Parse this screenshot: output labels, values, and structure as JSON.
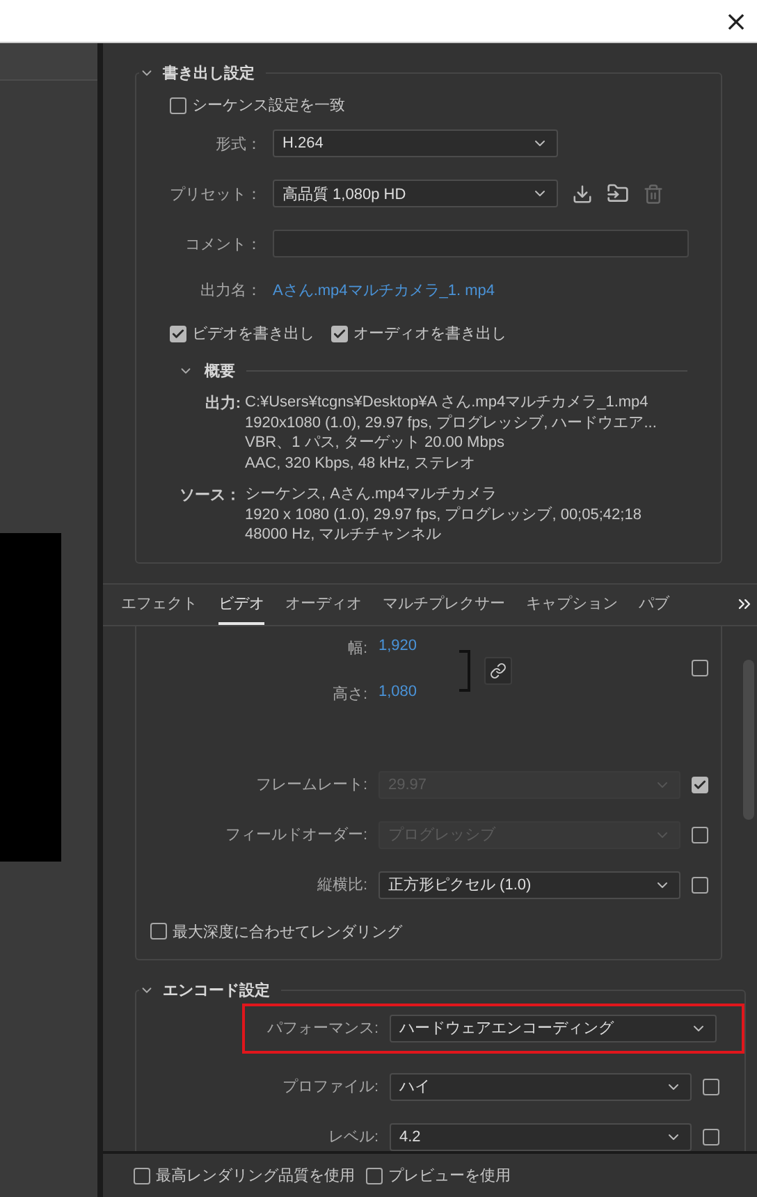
{
  "window": {
    "close": "×"
  },
  "export_settings": {
    "title": "書き出し設定",
    "match_sequence": {
      "label": "シーケンス設定を一致",
      "checked": false
    },
    "fields": [
      {
        "kind": "dropdown",
        "label": "形式：",
        "value": "H.264"
      },
      {
        "kind": "preset",
        "label": "プリセット：",
        "value": "高品質 1,080p HD"
      },
      {
        "kind": "input",
        "label": "コメント："
      },
      {
        "kind": "link",
        "label": "出力名：",
        "value": "Aさん.mp4マルチカメラ_1. mp4"
      }
    ],
    "export_options": [
      {
        "label": "ビデオを書き出し",
        "checked": true
      },
      {
        "label": "オーディオを書き出し",
        "checked": true
      }
    ],
    "summary": {
      "title": "概要",
      "groups": [
        {
          "label": "出力:",
          "lines": [
            "C:¥Users¥tcgns¥Desktop¥A さん.mp4マルチカメラ_1.mp4",
            "1920x1080 (1.0), 29.97 fps, プログレッシブ, ハードウエア...",
            "VBR、1 パス, ターゲット 20.00 Mbps",
            "AAC, 320 Kbps, 48 kHz, ステレオ"
          ]
        },
        {
          "label": "ソース：",
          "lines": [
            "シーケンス, Aさん.mp4マルチカメラ",
            "1920 x 1080 (1.0), 29.97 fps, プログレッシブ, 00;05;42;18",
            "48000  Hz, マルチチャンネル"
          ]
        }
      ]
    }
  },
  "tabs": [
    {
      "label": "エフェクト",
      "selected": false
    },
    {
      "label": "ビデオ",
      "selected": true
    },
    {
      "label": "オーディオ",
      "selected": false
    },
    {
      "label": "マルチプレクサー",
      "selected": false
    },
    {
      "label": "キャプション",
      "selected": false
    },
    {
      "label": "パブ",
      "selected": false
    }
  ],
  "video": {
    "width": {
      "label": "幅:",
      "value": "1,920"
    },
    "height": {
      "label": "高さ:",
      "value": "1,080"
    },
    "size_override": false,
    "rows": [
      {
        "label": "フレームレート:",
        "value": "29.97",
        "disabled": true,
        "checked": true
      },
      {
        "label": "フィールドオーダー:",
        "value": "プログレッシブ",
        "disabled": true,
        "checked": false
      },
      {
        "label": "縦横比:",
        "value": "正方形ピクセル (1.0)",
        "disabled": false,
        "checked": false
      }
    ],
    "max_depth": {
      "label": "最大深度に合わせてレンダリング",
      "checked": false
    }
  },
  "encoding": {
    "title": "エンコード設定",
    "rows": [
      {
        "label": "パフォーマンス:",
        "value": "ハードウェアエンコーディング",
        "highlighted": true
      },
      {
        "label": "プロファイル:",
        "value": "ハイ",
        "highlighted": false,
        "checked": false
      },
      {
        "label": "レベル:",
        "value": "4.2",
        "highlighted": false,
        "checked": false
      }
    ]
  },
  "footer": [
    {
      "label": "最高レンダリング品質を使用",
      "checked": false
    },
    {
      "label": "プレビューを使用",
      "checked": false
    }
  ]
}
